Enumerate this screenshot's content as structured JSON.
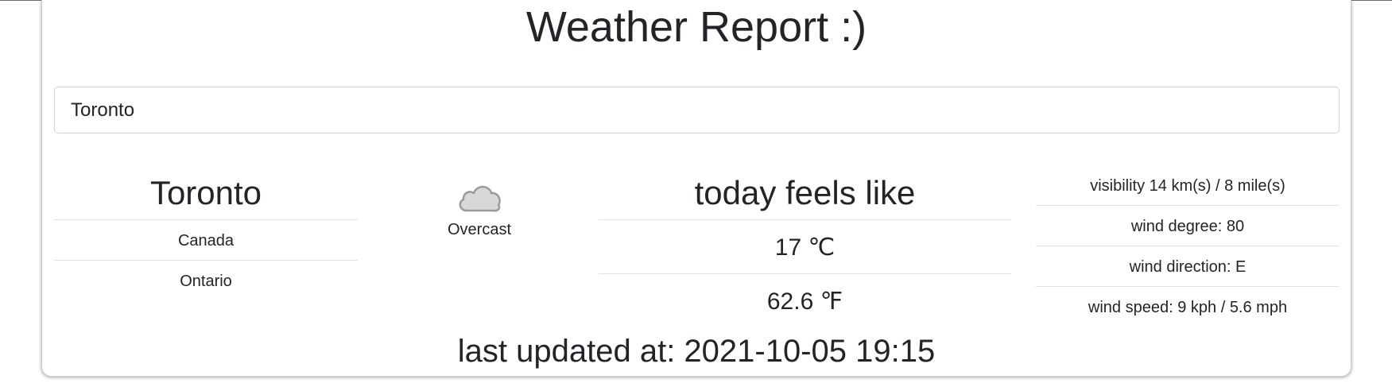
{
  "header": {
    "title": "Weather Report :)"
  },
  "search": {
    "value": "Toronto"
  },
  "location": {
    "city": "Toronto",
    "country": "Canada",
    "region": "Ontario"
  },
  "condition": {
    "icon": "cloud-icon",
    "text": "Overcast"
  },
  "feels_like": {
    "heading": "today feels like",
    "celsius": "17 ℃",
    "fahrenheit": "62.6 ℉"
  },
  "wind": {
    "visibility": "visibility 14 km(s) / 8 mile(s)",
    "degree": "wind degree: 80",
    "direction": "wind direction: E",
    "speed": "wind speed: 9 kph / 5.6 mph"
  },
  "footer": {
    "last_updated": "last updated at: 2021-10-05 19:15"
  },
  "colors": {
    "text": "#212529",
    "divider": "#dee2e6",
    "input_border": "#ced4da",
    "cloud": "#d8d8d8"
  }
}
